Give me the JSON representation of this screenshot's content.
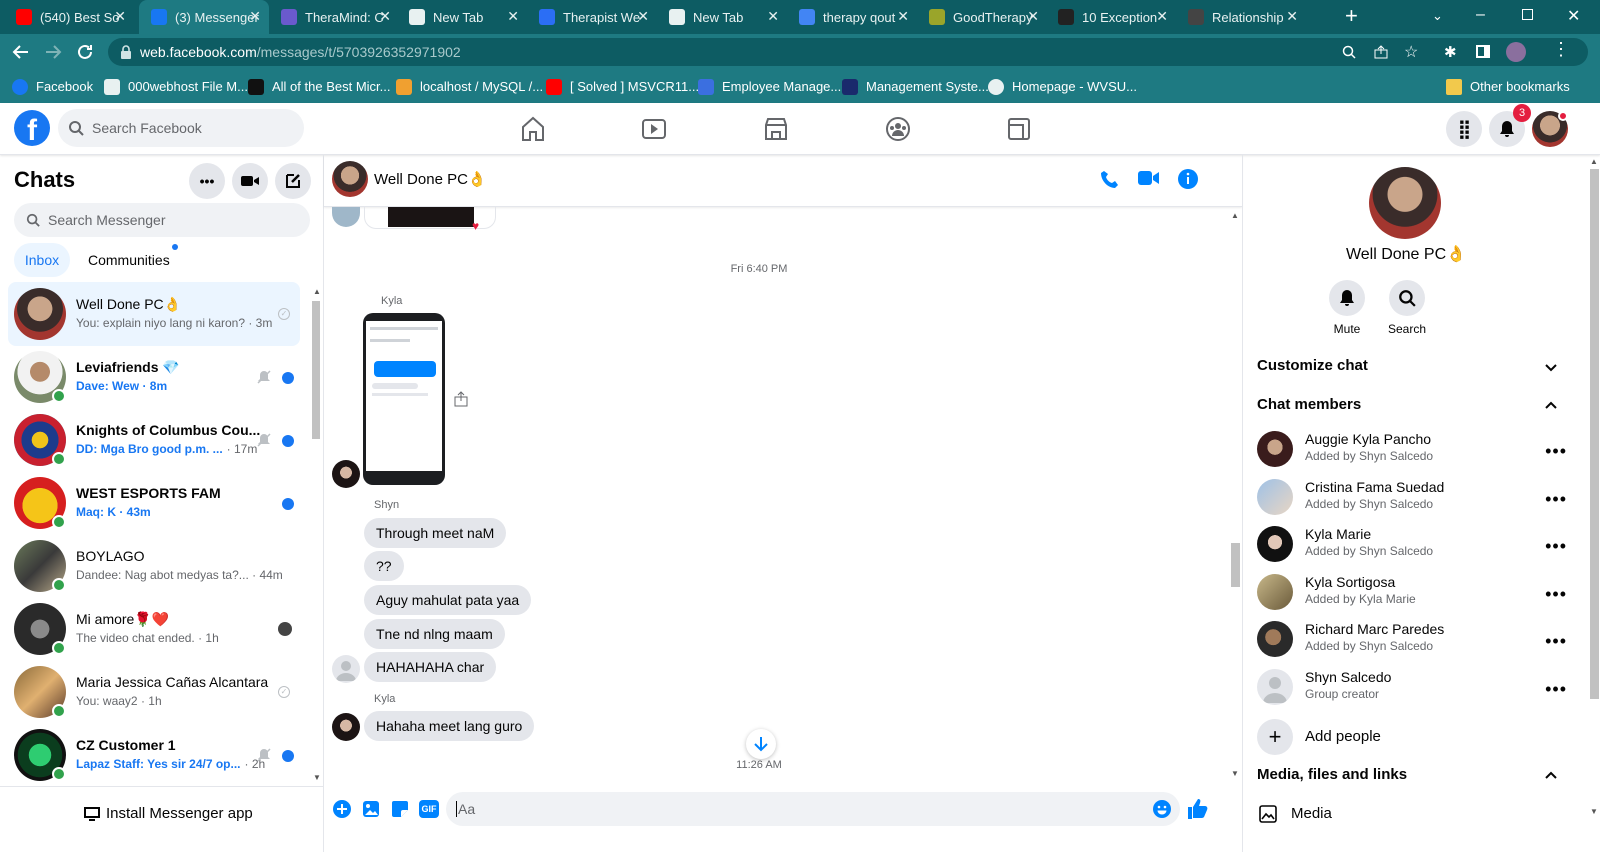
{
  "browser": {
    "tabs": [
      {
        "title": "(540) Best So",
        "icon": "youtube-icon",
        "color": "#ff0000"
      },
      {
        "title": "(3) Messenger",
        "icon": "facebook-icon",
        "color": "#1877f2"
      },
      {
        "title": "TheraMind: C",
        "icon": "theramind-icon",
        "color": "#6a5acd"
      },
      {
        "title": "New Tab",
        "icon": "chrome-icon",
        "color": "#e8f1f1"
      },
      {
        "title": "Therapist We",
        "icon": "s-icon",
        "color": "#2b6ef5"
      },
      {
        "title": "New Tab",
        "icon": "chrome-icon",
        "color": "#e8f1f1"
      },
      {
        "title": "therapy qout",
        "icon": "google-icon",
        "color": "#4285f4"
      },
      {
        "title": "GoodTherapy",
        "icon": "gt-icon",
        "color": "#9aa52a"
      },
      {
        "title": "10 Exception",
        "icon": "v-icon",
        "color": "#222"
      },
      {
        "title": "Relationship",
        "icon": "relationship-icon",
        "color": "#444"
      }
    ],
    "url_host": "web.facebook.com",
    "url_path": "/messages/t/5703926352971902",
    "bookmarks": [
      {
        "label": "Facebook",
        "icon": "facebook-icon"
      },
      {
        "label": "000webhost File M...",
        "icon": "webhost-icon"
      },
      {
        "label": "All of the Best Micr...",
        "icon": "htg-icon"
      },
      {
        "label": "localhost / MySQL /...",
        "icon": "phpmyadmin-icon"
      },
      {
        "label": "[ Solved ] MSVCR11...",
        "icon": "youtube-icon"
      },
      {
        "label": "Employee Manage...",
        "icon": "employee-icon"
      },
      {
        "label": "Management Syste...",
        "icon": "management-icon"
      },
      {
        "label": "Homepage - WVSU...",
        "icon": "wvsu-icon"
      }
    ],
    "other_bookmarks": "Other bookmarks"
  },
  "fb": {
    "search_placeholder": "Search Facebook",
    "notif_count": "3"
  },
  "chats": {
    "title": "Chats",
    "search_placeholder": "Search Messenger",
    "tab_inbox": "Inbox",
    "tab_communities": "Communities",
    "install": "Install Messenger app",
    "items": [
      {
        "name": "Well Done PC👌",
        "preview": "You: explain niyo lang ni karon? · 3m",
        "unread": false
      },
      {
        "name": "Leviafriends 💎",
        "preview": "Dave: Wew · 8m",
        "unread": true
      },
      {
        "name": "Knights of Columbus Cou...",
        "preview": "DD: Mga Bro good p.m. ...",
        "time": "· 17m",
        "unread": true
      },
      {
        "name": "WEST ESPORTS FAM",
        "preview": "Maq: K · 43m",
        "unread": true
      },
      {
        "name": "BOYLAGO",
        "preview": "Dandee: Nag abot medyas ta?... · 44m",
        "unread": false
      },
      {
        "name": "Mi amore🌹❤️",
        "preview": "The video chat ended. · 1h",
        "unread": false
      },
      {
        "name": "Maria Jessica Cañas Alcantara",
        "preview": "You: waay2 · 1h",
        "unread": false
      },
      {
        "name": "CZ Customer 1",
        "preview": "Lapaz Staff: Yes sir 24/7 op...",
        "time": "· 2h",
        "unread": true
      }
    ]
  },
  "conversation": {
    "title": "Well Done PC👌",
    "timestamp1": "Fri 6:40 PM",
    "sender_kyla": "Kyla",
    "sender_shyn": "Shyn",
    "messages": [
      "Through meet naM",
      "??",
      "Aguy mahulat pata yaa",
      "Tne nd nlng maam",
      "HAHAHAHA char",
      "Hahaha meet lang guro"
    ],
    "timestamp2": "11:26 AM",
    "input_placeholder": "Aa",
    "gif_label": "GIF"
  },
  "details": {
    "name": "Well Done PC👌",
    "mute": "Mute",
    "search": "Search",
    "customize": "Customize chat",
    "members_title": "Chat members",
    "members": [
      {
        "name": "Auggie Kyla Pancho",
        "sub": "Added by Shyn Salcedo"
      },
      {
        "name": "Cristina Fama Suedad",
        "sub": "Added by Shyn Salcedo"
      },
      {
        "name": "Kyla Marie",
        "sub": "Added by Shyn Salcedo"
      },
      {
        "name": "Kyla Sortigosa",
        "sub": "Added by Kyla Marie"
      },
      {
        "name": "Richard Marc Paredes",
        "sub": "Added by Shyn Salcedo"
      },
      {
        "name": "Shyn Salcedo",
        "sub": "Group creator"
      }
    ],
    "add_people": "Add people",
    "media_title": "Media, files and links",
    "media": "Media"
  }
}
